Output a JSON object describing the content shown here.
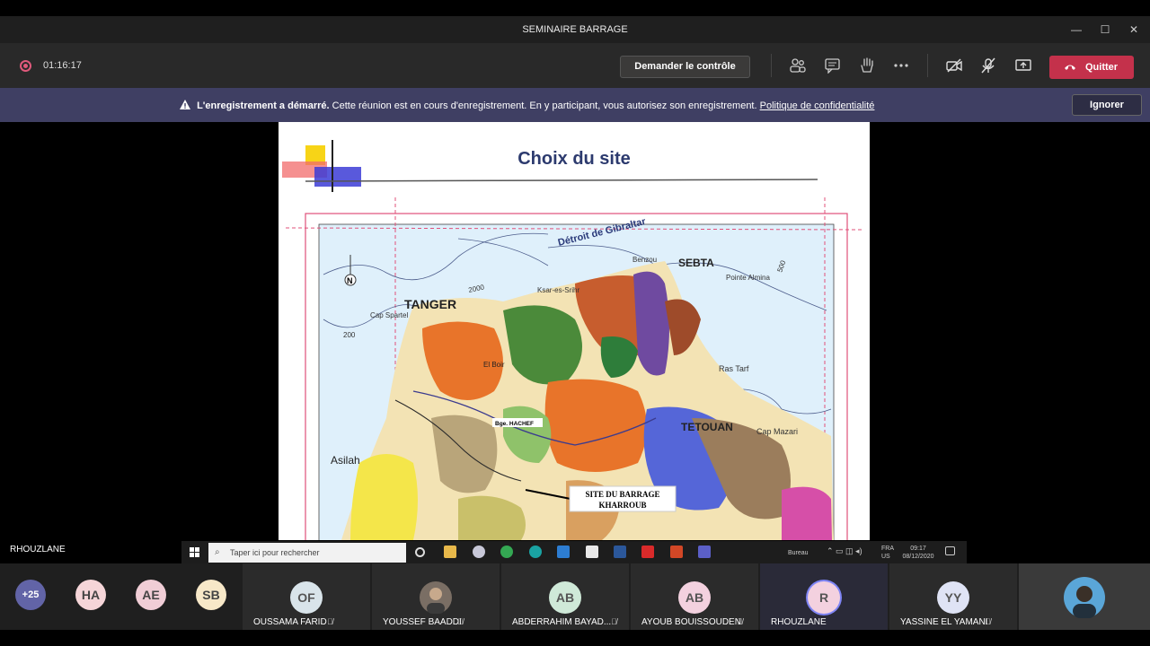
{
  "window": {
    "title": "SEMINAIRE BARRAGE"
  },
  "toolbar": {
    "timer": "01:16:17",
    "request_control_label": "Demander le contrôle",
    "leave_label": "Quitter"
  },
  "banner": {
    "bold_text": "L'enregistrement a démarré.",
    "message": "Cette réunion est en cours d'enregistrement. En y participant, vous autorisez son enregistrement.",
    "link": "Politique de confidentialité",
    "ignore_label": "Ignorer"
  },
  "slide": {
    "title": "Choix du site",
    "map_labels": {
      "detroit": "Détroit de Gibraltar",
      "sebta": "SEBTA",
      "tanger": "TANGER",
      "tetouan": "TETOUAN",
      "asilah": "Asilah",
      "cap_spartel": "Cap Spartel",
      "cap_mazari": "Cap Mazari",
      "ras_tarf": "Ras Tarf",
      "ksar": "Ksar-es-Srihr",
      "benzou": "Benzou",
      "pointe_almina": "Pointe Almina",
      "el_bohr": "El Boir",
      "bge_hachef": "Bge. HACHEF",
      "site_line1": "SITE DU BARRAGE",
      "site_line2": "KHARROUB",
      "north": "N",
      "depth_200": "200",
      "depth_500": "500",
      "depth_2000": "2000"
    }
  },
  "presenter": "RHOUZLANE",
  "taskbar": {
    "search_placeholder": "Taper ici pour rechercher",
    "tray_lang": "FRA",
    "tray_region": "US",
    "tray_time": "09:17",
    "tray_date": "08/12/2020",
    "tray_desktop": "Bureau"
  },
  "participants": {
    "overflow": "+25",
    "small": [
      {
        "initials": "HA",
        "color": "#f5d5d8"
      },
      {
        "initials": "AE",
        "color": "#f0cdd6"
      },
      {
        "initials": "SB",
        "color": "#f7e8c8"
      }
    ],
    "tiles": [
      {
        "initials": "OF",
        "name": "OUSSAMA FARID",
        "color": "#d9e4ea"
      },
      {
        "initials": "",
        "name": "YOUSSEF BAADDI",
        "color": "#8a7a6a"
      },
      {
        "initials": "AB",
        "name": "ABDERRAHIM BAYAD...",
        "color": "#cfe9d8"
      },
      {
        "initials": "AB",
        "name": "AYOUB BOUISSOUDEN",
        "color": "#f3d1df"
      },
      {
        "initials": "R",
        "name": "RHOUZLANE",
        "color": "#f3d1df"
      },
      {
        "initials": "YY",
        "name": "YASSINE EL YAMANI",
        "color": "#dfe3f5"
      }
    ]
  }
}
